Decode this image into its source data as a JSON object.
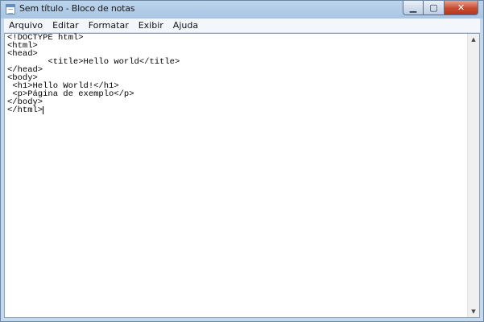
{
  "window": {
    "title": "Sem título - Bloco de notas",
    "buttons": {
      "minimize": "▁",
      "maximize": "▢",
      "close": "✕"
    }
  },
  "menu": [
    "Arquivo",
    "Editar",
    "Formatar",
    "Exibir",
    "Ajuda"
  ],
  "editor": {
    "lines": [
      "<!DOCTYPE html>",
      "<html>",
      "<head>",
      "\t<title>Hello world</title>",
      "</head>",
      "<body>",
      " <h1>Hello World!</h1>",
      " <p>Página de exemplo</p>",
      "</body>",
      "</html>"
    ]
  },
  "scrollbar": {
    "up_arrow": "▲",
    "down_arrow": "▼"
  }
}
